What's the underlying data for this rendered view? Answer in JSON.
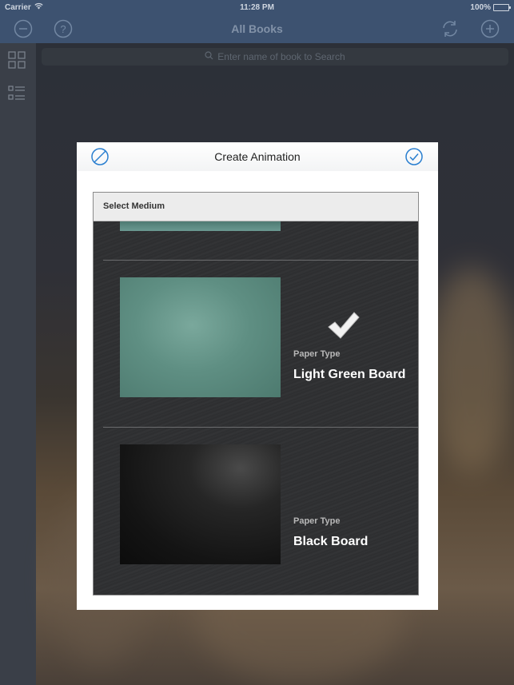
{
  "status_bar": {
    "carrier": "Carrier",
    "time": "11:28 PM",
    "battery": "100%",
    "battery_level": 1.0
  },
  "nav": {
    "title": "All Books",
    "left_icons": [
      "minus-circle-icon",
      "help-circle-icon"
    ],
    "right_icons": [
      "refresh-icon",
      "plus-circle-icon"
    ]
  },
  "sidebar": {
    "icons": [
      "grid-view-icon",
      "list-view-icon"
    ]
  },
  "search": {
    "placeholder": "Enter name of book to Search"
  },
  "modal": {
    "title": "Create Animation",
    "cancel_icon": "cancel-icon",
    "confirm_icon": "checkmark-circle-icon",
    "panel_title": "Select Medium",
    "media": [
      {
        "label": "Paper Type",
        "name": "Light Green Board",
        "selected": true
      },
      {
        "label": "Paper Type",
        "name": "Black Board",
        "selected": false
      }
    ]
  },
  "colors": {
    "bar": "#3d5270",
    "accent": "#2a7fd0",
    "panel": "#2f3032"
  }
}
